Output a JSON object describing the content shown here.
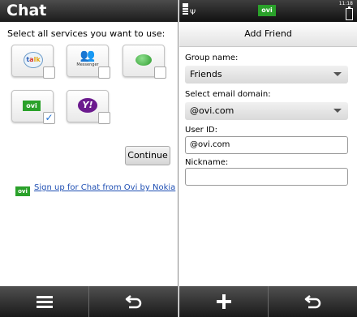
{
  "left": {
    "title": "Chat",
    "prompt": "Select all services you want to use:",
    "services": [
      {
        "name": "Google Talk",
        "logo_text": "talk",
        "checked": false
      },
      {
        "name": "Windows Live Messenger",
        "logo_text": "Messenger",
        "checked": false
      },
      {
        "name": "Chat bubble",
        "logo_text": "",
        "checked": false
      },
      {
        "name": "Ovi",
        "logo_text": "ovi",
        "checked": true
      },
      {
        "name": "Yahoo",
        "logo_text": "Y!",
        "checked": false
      }
    ],
    "continue_label": "Continue",
    "signup_logo": "ovi",
    "signup_link": "Sign up for Chat from Ovi by Nokia",
    "toolbar": [
      "menu-icon",
      "back-icon"
    ]
  },
  "right": {
    "status": {
      "ovi_badge": "ovi",
      "time": "11:18"
    },
    "title": "Add Friend",
    "group_label": "Group name:",
    "group_value": "Friends",
    "domain_label": "Select email domain:",
    "domain_value": "@ovi.com",
    "userid_label": "User ID:",
    "userid_value": "@ovi.com",
    "nickname_label": "Nickname:",
    "nickname_value": "",
    "toolbar": [
      "add-icon",
      "back-icon"
    ]
  },
  "colors": {
    "ovi_green": "#2aa12a",
    "link_blue": "#1f4fb3",
    "check_blue": "#1e6fd2",
    "bar_dark": "#1a1a1a"
  }
}
